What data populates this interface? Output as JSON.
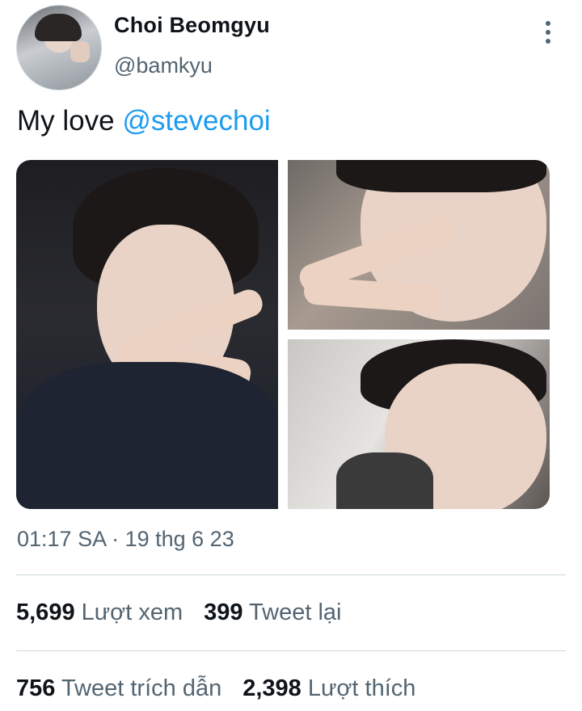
{
  "author": {
    "name": "Choi Beomgyu",
    "handle": "@bamkyu"
  },
  "tweet": {
    "text": "My love ",
    "mention": "@stevechoi",
    "timestamp": "01:17 SA · 19 thg 6 23"
  },
  "stats": {
    "row1": [
      {
        "value": "5,699",
        "label": "Lượt xem"
      },
      {
        "value": "399",
        "label": "Tweet lại"
      }
    ],
    "row2": [
      {
        "value": "756",
        "label": "Tweet trích dẫn"
      },
      {
        "value": "2,398",
        "label": "Lượt thích"
      }
    ]
  },
  "icons": {
    "more": "more-vertical-icon"
  },
  "colors": {
    "mention": "#1d9bf0",
    "secondary_text": "#536471",
    "primary_text": "#0f1419",
    "divider": "#cfd9de"
  }
}
